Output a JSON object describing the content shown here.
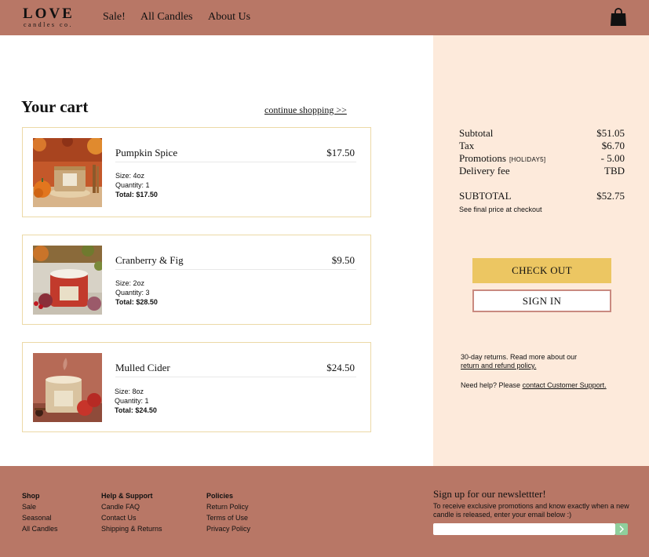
{
  "header": {
    "logo_main": "LOVE",
    "logo_sub": "candles co.",
    "nav": [
      "Sale!",
      "All Candles",
      "About Us"
    ],
    "cart_icon": "shopping-bag-icon"
  },
  "cart": {
    "title": "Your cart",
    "continue_label": "continue shopping >>",
    "items": [
      {
        "name": "Pumpkin Spice",
        "price": "$17.50",
        "size": "Size: 4oz",
        "quantity": "Quantity: 1",
        "total": "Total: $17.50",
        "image": "pumpkin-spice-candle-image"
      },
      {
        "name": "Cranberry & Fig",
        "price": "$9.50",
        "size": "Size: 2oz",
        "quantity": "Quantity: 3",
        "total": "Total: $28.50",
        "image": "cranberry-fig-candle-image"
      },
      {
        "name": "Mulled Cider",
        "price": "$24.50",
        "size": "Size: 8oz",
        "quantity": "Quantity: 1",
        "total": "Total: $24.50",
        "image": "mulled-cider-candle-image"
      }
    ]
  },
  "summary": {
    "subtotal_label": "Subtotal",
    "subtotal_value": "$51.05",
    "tax_label": "Tax",
    "tax_value": "$6.70",
    "promotions_label": "Promotions",
    "promo_code": "[HOLIDAY5]",
    "promotions_value": "- 5.00",
    "delivery_label": "Delivery fee",
    "delivery_value": "TBD",
    "grand_label": "SUBTOTAL",
    "grand_value": "$52.75",
    "final_note": "See final price at checkout",
    "checkout_label": "CHECK OUT",
    "signin_label": "SIGN IN",
    "returns_text": "30-day returns. Read more about our",
    "returns_link": "return and refund policy.",
    "help_text": "Need help? Please",
    "help_link": "contact Customer Support."
  },
  "footer": {
    "columns": [
      {
        "heading": "Shop",
        "items": [
          "Sale",
          "Seasonal",
          "All Candles"
        ]
      },
      {
        "heading": "Help & Support",
        "items": [
          "Candle FAQ",
          "Contact Us",
          "Shipping & Returns"
        ]
      },
      {
        "heading": "Policies",
        "items": [
          "Return Policy",
          "Terms of Use",
          "Privacy Policy"
        ]
      }
    ],
    "newsletter_title": "Sign up for our newslettter!",
    "newsletter_desc": "To receive exclusive promotions and know exactly when a new candle is released, enter your email below :)",
    "email_placeholder": ""
  },
  "colors": {
    "header_bg": "#b87766",
    "panel_bg": "#fdeadb",
    "checkout_bg": "#ecc662",
    "signin_border": "#c98a80",
    "card_border": "#ecd9a6",
    "submit_bg": "#8fcf9c"
  }
}
